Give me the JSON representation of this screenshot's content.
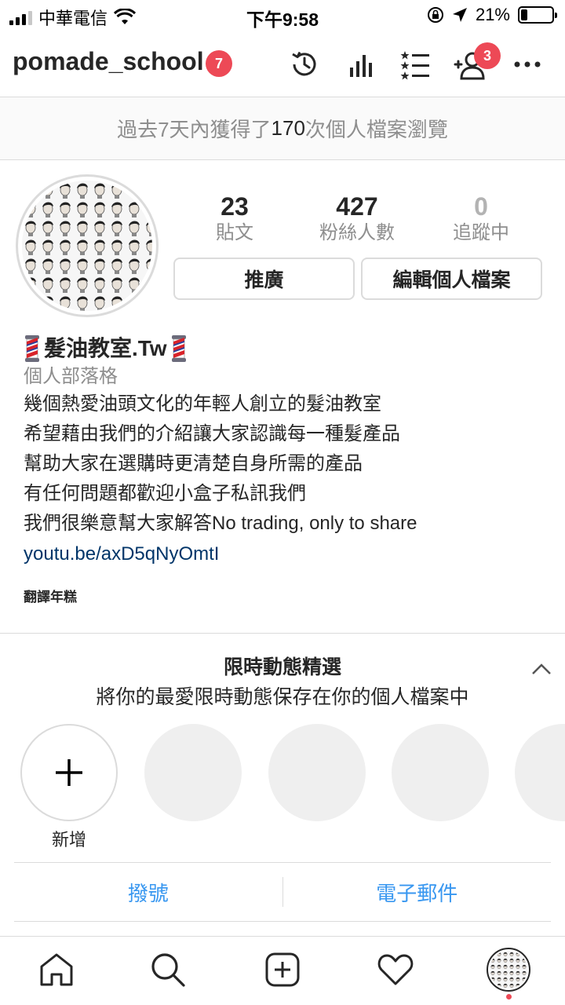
{
  "status_bar": {
    "carrier": "中華電信",
    "time": "下午9:58",
    "battery": "21%",
    "battery_fraction": 0.21
  },
  "header": {
    "username": "pomade_school",
    "notification_count": "7",
    "follow_request_count": "3",
    "icons": [
      "archive-history-icon",
      "insights-bars-icon",
      "close-friends-list-icon",
      "discover-people-icon",
      "more-options-icon"
    ]
  },
  "views_banner": {
    "prefix": "過去7天內獲得了",
    "count": "170",
    "suffix": "次個人檔案瀏覽"
  },
  "stats": {
    "posts": {
      "value": "23",
      "label": "貼文"
    },
    "followers": {
      "value": "427",
      "label": "粉絲人數"
    },
    "following": {
      "value": "0",
      "label": "追蹤中"
    }
  },
  "buttons": {
    "promote": "推廣",
    "edit_profile": "編輯個人檔案"
  },
  "bio": {
    "name": "髮油教室.Tw",
    "category": "個人部落格",
    "lines": [
      "幾個熱愛油頭文化的年輕人創立的髮油教室",
      "希望藉由我們的介紹讓大家認識每一種髮產品",
      "幫助大家在選購時更清楚自身所需的產品",
      "有任何問題都歡迎小盒子私訊我們",
      "我們很樂意幫大家解答No trading, only to share"
    ],
    "link": "youtu.be/axD5qNyOmtI",
    "translate": "翻譯年糕"
  },
  "highlights": {
    "title": "限時動態精選",
    "subtitle": "將你的最愛限時動態保存在你的個人檔案中",
    "new_label": "新增"
  },
  "contact": {
    "call": "撥號",
    "email": "電子郵件"
  },
  "colors": {
    "accent_blue": "#3897f0",
    "badge_red": "#ed4956",
    "link": "#003569",
    "muted": "#8e8e8e",
    "border": "#dbdbdb"
  }
}
